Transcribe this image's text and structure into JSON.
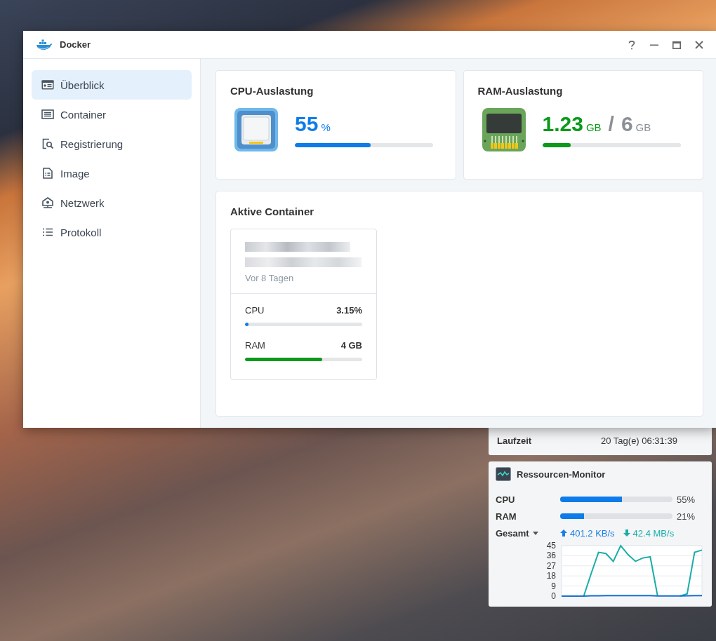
{
  "window": {
    "title": "Docker"
  },
  "sidebar": {
    "items": [
      {
        "label": "Überblick",
        "selected": true
      },
      {
        "label": "Container",
        "selected": false
      },
      {
        "label": "Registrierung",
        "selected": false
      },
      {
        "label": "Image",
        "selected": false
      },
      {
        "label": "Netzwerk",
        "selected": false
      },
      {
        "label": "Protokoll",
        "selected": false
      }
    ]
  },
  "cpu_card": {
    "title": "CPU-Auslastung",
    "value": "55",
    "unit": "%",
    "level": 0.55
  },
  "ram_card": {
    "title": "RAM-Auslastung",
    "used": "1.23",
    "used_unit": "GB",
    "separator": "/",
    "total": "6",
    "total_unit": "GB",
    "level": 0.205
  },
  "active_containers": {
    "title": "Aktive Container",
    "containers": [
      {
        "age": "Vor 8 Tagen",
        "metrics": [
          {
            "label": "CPU",
            "value": "3.15%",
            "level": 0.03,
            "color": "#0a7ee8"
          },
          {
            "label": "RAM",
            "value": "4 GB",
            "level": 0.66,
            "color": "#0a9a1a"
          }
        ]
      }
    ]
  },
  "uptime_widget": {
    "label": "Laufzeit",
    "value": "20 Tag(e) 06:31:39"
  },
  "resource_monitor": {
    "title": "Ressourcen-Monitor",
    "meters": [
      {
        "label": "CPU",
        "level": 0.55,
        "reading": "55%"
      },
      {
        "label": "RAM",
        "level": 0.21,
        "reading": "21%"
      }
    ],
    "network": {
      "scope": "Gesamt",
      "upload": "401.2 KB/s",
      "download": "42.4 MB/s"
    },
    "chart_data": {
      "type": "line",
      "ylim": [
        0,
        45
      ],
      "yticks": [
        0,
        9,
        18,
        27,
        36,
        45
      ],
      "grid": true,
      "series": [
        {
          "color": "#1aada8",
          "values": [
            null,
            null,
            null,
            0,
            20,
            39,
            38,
            31,
            45,
            37,
            31,
            34,
            35,
            0,
            null,
            null,
            0,
            2,
            39,
            41
          ]
        },
        {
          "color": "#1a6fd8",
          "values": [
            0,
            0,
            0,
            0,
            0.3,
            0.3,
            0.4,
            0.4,
            0.5,
            0.4,
            0.4,
            0.4,
            0.4,
            0.2,
            0.2,
            0.2,
            0.2,
            0.3,
            0.4,
            0.4
          ]
        }
      ]
    }
  }
}
